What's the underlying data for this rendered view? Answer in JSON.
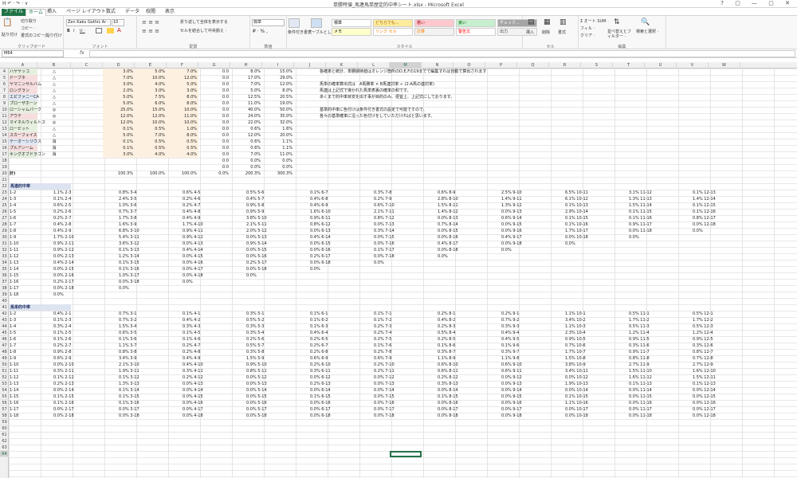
{
  "window": {
    "title": "単勝時値_馬連馬単歴定的中率シート.xlsx - Microsoft Excel",
    "qat": "H  ↶ · ↷ ·  ∨",
    "controls": "? ▢ — ▢ ✕"
  },
  "tabs": [
    "ファイル",
    "ホーム",
    "挿入",
    "ページ レイアウト",
    "数式",
    "データ",
    "校閲",
    "表示"
  ],
  "ribbon": {
    "clipboard": {
      "paste": "貼り付け",
      "cut": "切り取り",
      "copy": "コピー ·",
      "format": "書式のコピー/貼り付け",
      "label": "クリップボード"
    },
    "font": {
      "name": "Zen Kaku Gothic Ar ·",
      "size": "10 ·",
      "bold": "B",
      "italic": "I",
      "underline": "U ·",
      "label": "フォント"
    },
    "align": {
      "wrap": "折り返して全体を表示する",
      "merge": "セルを結合して中央揃え ·",
      "label": "配置"
    },
    "number": {
      "format": "標準",
      "label": "数値"
    },
    "styles": {
      "cond": "条件付き書式 ·",
      "table": "テーブルとして書式設定 ·",
      "label": "スタイル",
      "cells": [
        {
          "t": "標準",
          "bg": "#ffffff",
          "fg": "#000000"
        },
        {
          "t": "どちらでも...",
          "bg": "#ffeb9c",
          "fg": "#9c6500"
        },
        {
          "t": "悪い",
          "bg": "#ffc7ce",
          "fg": "#9c0006"
        },
        {
          "t": "良い",
          "bg": "#c6efce",
          "fg": "#006100"
        },
        {
          "t": "チェック...",
          "bg": "#a5a5a5",
          "fg": "#ffffff"
        },
        {
          "t": "メモ",
          "bg": "#ffffcc",
          "fg": "#000000"
        },
        {
          "t": "リンク セル",
          "bg": "#ffffff",
          "fg": "#fa7d00"
        },
        {
          "t": "計算",
          "bg": "#f2f2f2",
          "fg": "#fa7d00"
        },
        {
          "t": "警告文",
          "bg": "#ffffff",
          "fg": "#ff0000"
        },
        {
          "t": "出力",
          "bg": "#f2f2f2",
          "fg": "#3f3f3f"
        }
      ]
    },
    "cells": {
      "insert": "挿入",
      "delete": "削除",
      "format": "書式",
      "label": "セル"
    },
    "edit": {
      "autosum": "Σ オート SUM ·",
      "fill": "フィル ·",
      "clear": "クリア ·",
      "sort": "並べ替えとフィルター ·",
      "find": "検索と選択 ·",
      "label": "編集"
    }
  },
  "namebox": "M64",
  "fx": "fx",
  "columns": [
    "A",
    "B",
    "C",
    "D",
    "E",
    "F",
    "G",
    "H",
    "I",
    "J",
    "K",
    "L",
    "M",
    "N",
    "O",
    "P",
    "Q",
    "R",
    "S",
    "T",
    "U",
    "V",
    "W"
  ],
  "selected_column": "M",
  "horses": [
    {
      "r": 4,
      "name": "ハヤヤッコ",
      "mark": "△",
      "d": "3.0%",
      "e": "5.0%",
      "f": "7.0%",
      "g": "0.0",
      "h": "8.0%",
      "i": "15.0%",
      "bg": "#e6f0e0"
    },
    {
      "r": 5,
      "name": "ドーブネ",
      "mark": "△",
      "d": "7.0%",
      "e": "10.0%",
      "f": "12.0%",
      "g": "0.0",
      "h": "17.0%",
      "i": "29.0%",
      "bg": "#f6dede"
    },
    {
      "r": 6,
      "name": "ヤマニンサルバム",
      "mark": "△",
      "d": "3.0%",
      "e": "4.0%",
      "f": "5.0%",
      "g": "0.0",
      "h": "7.0%",
      "i": "12.0%",
      "bg": "#f6dede"
    },
    {
      "r": 7,
      "name": "ロングラン",
      "mark": "△",
      "d": "2.0%",
      "e": "3.0%",
      "f": "3.0%",
      "g": "0.0",
      "h": "5.0%",
      "i": "8.0%",
      "bg": "#f6dede"
    },
    {
      "r": 8,
      "name": "エピファニーCA",
      "mark": "△",
      "d": "5.0%",
      "e": "7.5%",
      "f": "8.0%",
      "g": "0.0",
      "h": "12.5%",
      "i": "20.5%",
      "bg": "#e0e8f4"
    },
    {
      "r": 9,
      "name": "プローザホーン",
      "mark": "△",
      "d": "5.0%",
      "e": "6.0%",
      "f": "8.0%",
      "g": "0.0",
      "h": "11.0%",
      "i": "19.0%",
      "bg": "#e6f0e0"
    },
    {
      "r": 10,
      "name": "ローシャムパーク",
      "mark": "◎",
      "d": "25.0%",
      "e": "15.0%",
      "f": "10.0%",
      "g": "0.0",
      "h": "40.0%",
      "i": "50.0%",
      "bg": "#e6f0e0"
    },
    {
      "r": 11,
      "name": "アウテ",
      "mark": "◎",
      "d": "12.0%",
      "e": "12.0%",
      "f": "11.0%",
      "g": "0.0",
      "h": "24.0%",
      "i": "35.0%",
      "bg": "#f6dede"
    },
    {
      "r": 12,
      "name": "マイネルウィルトス",
      "mark": "◎",
      "d": "12.0%",
      "e": "10.0%",
      "f": "10.0%",
      "g": "0.0",
      "h": "22.0%",
      "i": "32.0%",
      "bg": "#e6f0e0"
    },
    {
      "r": 13,
      "name": "ロービット",
      "mark": "△",
      "d": "0.1%",
      "e": "0.5%",
      "f": "1.0%",
      "g": "0.0",
      "h": "0.6%",
      "i": "1.6%",
      "bg": "#e6f0e0"
    },
    {
      "r": 14,
      "name": "スカーフェイス",
      "mark": "△",
      "d": "5.0%",
      "e": "7.0%",
      "f": "8.0%",
      "g": "0.0",
      "h": "12.0%",
      "i": "20.0%",
      "bg": "#f6dede"
    },
    {
      "r": 15,
      "name": "テーオーシリウス",
      "mark": "消",
      "d": "0.1%",
      "e": "0.5%",
      "f": "0.5%",
      "g": "0.0",
      "h": "0.6%",
      "i": "1.1%",
      "bg": "#e0e8f4"
    },
    {
      "r": 16,
      "name": "プルアンーム",
      "mark": "消",
      "d": "0.1%",
      "e": "0.5%",
      "f": "0.5%",
      "g": "0.0",
      "h": "0.6%",
      "i": "1.1%",
      "bg": "#f6dede"
    },
    {
      "r": 17,
      "name": "キングオブドラゴン",
      "mark": "消",
      "d": "3.0%",
      "e": "4.0%",
      "f": "4.0%",
      "g": "0.0",
      "h": "7.0%",
      "i": "11.0%",
      "bg": "#e6f0e0"
    },
    {
      "r": 18,
      "name": "",
      "mark": "",
      "d": "",
      "e": "",
      "f": "",
      "g": "0.0",
      "h": "0.0%",
      "i": "0.0%",
      "bg": ""
    },
    {
      "r": 19,
      "name": "",
      "mark": "",
      "d": "",
      "e": "",
      "f": "",
      "g": "0.0",
      "h": "0.0%",
      "i": "0.0%",
      "bg": ""
    },
    {
      "r": 20,
      "name": "計)",
      "mark": "",
      "d": "100.3%",
      "e": "100.0%",
      "f": "100.0%",
      "g": "0.0%",
      "h": "200.3%",
      "i": "300.3%",
      "bg": ""
    }
  ],
  "notes": [
    {
      "r": 4,
      "t": "各確率と統計、単勝期待値はオレンジ箇所のD,E,Fの19までで編集すれば自動で算出されます"
    },
    {
      "r": 6,
      "t": "馬単の確率算出式は　A馬勝率 × B馬連対率 ÷ (2-A馬の連対率)"
    },
    {
      "r": 7,
      "t": "馬連は上記式で導かれた馬単表裏の確率の和です。"
    },
    {
      "r": 8,
      "t": "あくまで的中率目安を出す事が目的のみ、便宜上、上記式にしております。"
    },
    {
      "r": 10,
      "t": "基準的中率に色付けは条件付き書式の設定で可能ですので、"
    },
    {
      "r": 11,
      "t": "各々の基準確率に沿った色付けをしていただければと思います。"
    }
  ],
  "section1": "馬連的中率",
  "section2": "馬単的中率",
  "umaren": [
    [
      "1.1% 2-3",
      "0.8% 3-4",
      "0.6% 4-5",
      "0.5% 5-6",
      "0.1% 6-7",
      "0.3% 7-8",
      "0.6% 8-9",
      "2.5% 9-10",
      "6.5% 10-11",
      "3.1% 11-12",
      "0.1% 12-13"
    ],
    [
      "0.1% 2-4",
      "2.4% 3-5",
      "0.2% 4-6",
      "0.4% 5-7",
      "0.4% 6-8",
      "0.2% 7-9",
      "2.8% 8-10",
      "1.4% 9-11",
      "6.1% 10-12",
      "1.3% 11-13",
      "1.4% 12-14"
    ],
    [
      "0.6% 2-5",
      "1.0% 3-6",
      "0.2% 4-7",
      "0.9% 5-8",
      "0.4% 6-9",
      "0.6% 7-10",
      "1.5% 8-11",
      "1.3% 9-12",
      "0.1% 10-13",
      "1.5% 11-14",
      "0.1% 12-15"
    ],
    [
      "0.2% 2-6",
      "0.7% 3-7",
      "0.4% 4-8",
      "0.9% 5-9",
      "1.6% 6-10",
      "2.1% 7-11",
      "1.4% 8-12",
      "0.0% 9-13",
      "2.9% 10-14",
      "0.1% 11-15",
      "0.1% 12-16"
    ],
    [
      "0.2% 2-7",
      "1.7% 3-8",
      "0.4% 4-9",
      "3.8% 5-10",
      "0.9% 6-11",
      "0.8% 7-12",
      "0.0% 8-13",
      "0.6% 9-14",
      "0.1% 10-15",
      "0.1% 11-16",
      "0.8% 12-17"
    ],
    [
      "0.4% 2-8",
      "1.6% 3-9",
      "1.7% 4-10",
      "2.1% 5-11",
      "0.8% 6-12",
      "0.0% 7-13",
      "0.7% 8-14",
      "0.0% 9-15",
      "0.1% 10-16",
      "0.9% 11-17",
      "0.0% 12-18"
    ],
    [
      "0.4% 2-9",
      "6.8% 3-10",
      "0.9% 4-11",
      "2.0% 5-12",
      "0.0% 6-13",
      "0.3% 7-14",
      "0.0% 8-15",
      "0.0% 9-16",
      "1.7% 10-17",
      "0.0% 11-18",
      "0.0%"
    ],
    [
      "1.7% 2-10",
      "5.4% 3-11",
      "0.9% 4-12",
      "0.0% 5-13",
      "0.4% 6-14",
      "0.0% 7-15",
      "0.0% 8-16",
      "0.4% 9-17",
      "0.0% 10-18",
      "0.0%",
      ""
    ],
    [
      "0.9% 2-11",
      "3.6% 3-12",
      "0.0% 4-13",
      "0.9% 5-14",
      "0.0% 6-15",
      "0.0% 7-16",
      "0.4% 8-17",
      "0.0% 9-18",
      "0.0%",
      "",
      ""
    ],
    [
      "0.9% 2-12",
      "0.1% 3-13",
      "0.4% 4-14",
      "0.0% 5-15",
      "0.0% 6-16",
      "0.1% 7-17",
      "0.0% 8-18",
      "0.0%",
      "",
      "",
      ""
    ],
    [
      "0.0% 2-13",
      "1.2% 3-14",
      "0.0% 4-15",
      "0.0% 5-16",
      "0.2% 6-17",
      "0.0% 7-18",
      "0.0%",
      "",
      "",
      "",
      ""
    ],
    [
      "0.4% 2-14",
      "0.1% 3-15",
      "0.0% 4-16",
      "0.2% 5-17",
      "0.0% 6-18",
      "0.0%",
      "",
      "",
      "",
      "",
      ""
    ],
    [
      "0.0% 2-15",
      "0.1% 3-16",
      "0.0% 4-17",
      "0.0% 5-18",
      "0.0%",
      "",
      "",
      "",
      "",
      "",
      ""
    ],
    [
      "0.0% 2-16",
      "1.0% 3-17",
      "0.0% 4-18",
      "0.0%",
      "",
      "",
      "",
      "",
      "",
      "",
      ""
    ],
    [
      "0.2% 2-17",
      "0.0% 3-18",
      "0.0%",
      "",
      "",
      "",
      "",
      "",
      "",
      "",
      ""
    ],
    [
      "0.0% 2-18",
      "0.0%",
      "",
      "",
      "",
      "",
      "",
      "",
      "",
      "",
      ""
    ],
    [
      "0.0%",
      "",
      "",
      "",
      "",
      "",
      "",
      "",
      "",
      "",
      ""
    ]
  ],
  "umaren_a": [
    "1-2",
    "1-3",
    "1-4",
    "1-5",
    "1-6",
    "1-7",
    "1-8",
    "1-9",
    "1-10",
    "1-11",
    "1-12",
    "1-13",
    "1-14",
    "1-15",
    "1-16",
    "1-17",
    "1-18"
  ],
  "umatan": [
    [
      "0.4% 2-1",
      "0.7% 3-1",
      "0.1% 4-1",
      "0.3% 5-1",
      "0.1% 6-1",
      "0.1% 7-1",
      "0.2% 8-1",
      "0.2% 9-1",
      "1.1% 10-1",
      "0.5% 11-1",
      "0.5% 12-1"
    ],
    [
      "0.1% 2-3",
      "0.7% 3-2",
      "0.4% 4-2",
      "0.5% 5-2",
      "0.1% 6-2",
      "0.1% 7-2",
      "0.4% 8-2",
      "0.7% 9-2",
      "3.4% 10-2",
      "1.7% 11-2",
      "1.7% 12-2"
    ],
    [
      "0.3% 2-4",
      "1.5% 3-4",
      "0.3% 4-3",
      "0.3% 5-3",
      "0.1% 6-3",
      "0.2% 7-3",
      "0.2% 8-3",
      "0.3% 9-3",
      "1.1% 10-3",
      "0.5% 11-3",
      "0.5% 12-3"
    ],
    [
      "0.1% 2-5",
      "0.6% 3-5",
      "0.1% 4-5",
      "0.3% 5-4",
      "0.4% 6-4",
      "0.2% 7-4",
      "0.5% 8-4",
      "0.4% 9-4",
      "2.3% 10-4",
      "1.2% 11-4",
      "1.2% 12-4"
    ],
    [
      "0.1% 2-6",
      "0.1% 3-6",
      "0.1% 4-6",
      "0.2% 5-6",
      "0.2% 6-5",
      "0.2% 7-5",
      "0.2% 8-5",
      "0.4% 9-5",
      "0.9% 10-5",
      "0.9% 11-5",
      "0.9% 12-5"
    ],
    [
      "0.2% 2-7",
      "1.1% 3-7",
      "0.2% 4-7",
      "0.5% 5-7",
      "0.2% 6-7",
      "0.1% 7-6",
      "0.1% 8-6",
      "0.1% 9-6",
      "0.7% 10-6",
      "0.3% 11-6",
      "0.3% 12-6"
    ],
    [
      "0.9% 2-8",
      "0.8% 3-8",
      "0.2% 4-8",
      "0.3% 5-8",
      "0.2% 6-8",
      "0.2% 7-8",
      "0.3% 8-7",
      "0.3% 9-7",
      "1.7% 10-7",
      "0.9% 11-7",
      "0.8% 12-7"
    ],
    [
      "0.6% 2-9",
      "3.4% 3-9",
      "0.4% 4-9",
      "1.5% 5-9",
      "0.6% 6-9",
      "0.6% 7-9",
      "1.1% 8-9",
      "1.1% 9-8",
      "1.5% 10-8",
      "0.8% 11-8",
      "0.7% 12-8"
    ],
    [
      "0.0% 2-10",
      "2.1% 3-10",
      "0.4% 4-10",
      "0.9% 5-10",
      "0.2% 6-10",
      "0.2% 7-10",
      "0.6% 8-10",
      "0.6% 9-10",
      "3.8% 10-9",
      "2.7% 11-9",
      "2.7% 12-9"
    ],
    [
      "0.3% 2-11",
      "1.9% 3-11",
      "0.3% 4-11",
      "0.8% 5-11",
      "0.3% 6-11",
      "0.2% 7-11",
      "0.6% 8-11",
      "0.6% 9-11",
      "3.4% 10-11",
      "1.5% 11-10",
      "1.6% 12-10"
    ],
    [
      "0.1% 2-12",
      "0.1% 3-12",
      "0.2% 4-12",
      "0.0% 5-12",
      "0.0% 6-12",
      "0.0% 7-12",
      "0.2% 8-12",
      "0.0% 9-12",
      "0.0% 10-12",
      "1.6% 11-12",
      "1.5% 12-11"
    ],
    [
      "0.2% 2-13",
      "1.3% 3-13",
      "0.0% 4-13",
      "0.0% 5-13",
      "0.2% 6-13",
      "0.0% 7-13",
      "0.3% 8-13",
      "0.0% 9-13",
      "1.9% 10-13",
      "0.1% 11-13",
      "0.1% 12-13"
    ],
    [
      "0.0% 2-14",
      "0.1% 3-14",
      "0.0% 4-14",
      "0.0% 5-14",
      "0.0% 6-14",
      "0.0% 7-14",
      "0.0% 8-14",
      "0.0% 9-14",
      "0.0% 10-14",
      "0.0% 11-14",
      "0.0% 12-14"
    ],
    [
      "0.1% 2-15",
      "0.1% 3-15",
      "0.0% 4-15",
      "0.0% 5-15",
      "0.1% 6-15",
      "0.0% 7-15",
      "0.1% 8-15",
      "0.0% 9-15",
      "0.1% 10-15",
      "0.0% 11-15",
      "0.0% 12-15"
    ],
    [
      "0.1% 2-16",
      "0.1% 3-16",
      "0.0% 4-16",
      "0.0% 5-16",
      "0.0% 6-16",
      "0.0% 7-16",
      "0.0% 8-16",
      "0.0% 9-16",
      "1.1% 10-16",
      "0.0% 11-16",
      "0.0% 12-16"
    ],
    [
      "0.0% 2-17",
      "0.0% 3-17",
      "0.0% 4-17",
      "0.0% 5-17",
      "0.0% 6-17",
      "0.0% 7-17",
      "0.0% 8-17",
      "0.0% 9-17",
      "0.0% 10-17",
      "0.0% 11-17",
      "0.0% 12-17"
    ],
    [
      "0.0% 2-18",
      "0.0% 3-18",
      "0.0% 4-18",
      "0.0% 5-18",
      "0.0% 6-18",
      "0.0% 7-18",
      "0.0% 8-18",
      "0.0% 9-18",
      "0.0% 10-18",
      "0.0% 11-18",
      "0.0% 12-18"
    ]
  ],
  "umatan_a": [
    "1-2",
    "1-3",
    "1-4",
    "1-5",
    "1-6",
    "1-7",
    "1-8",
    "1-9",
    "1-10",
    "1-11",
    "1-12",
    "1-13",
    "1-14",
    "1-15",
    "1-16",
    "1-17",
    "1-18"
  ]
}
